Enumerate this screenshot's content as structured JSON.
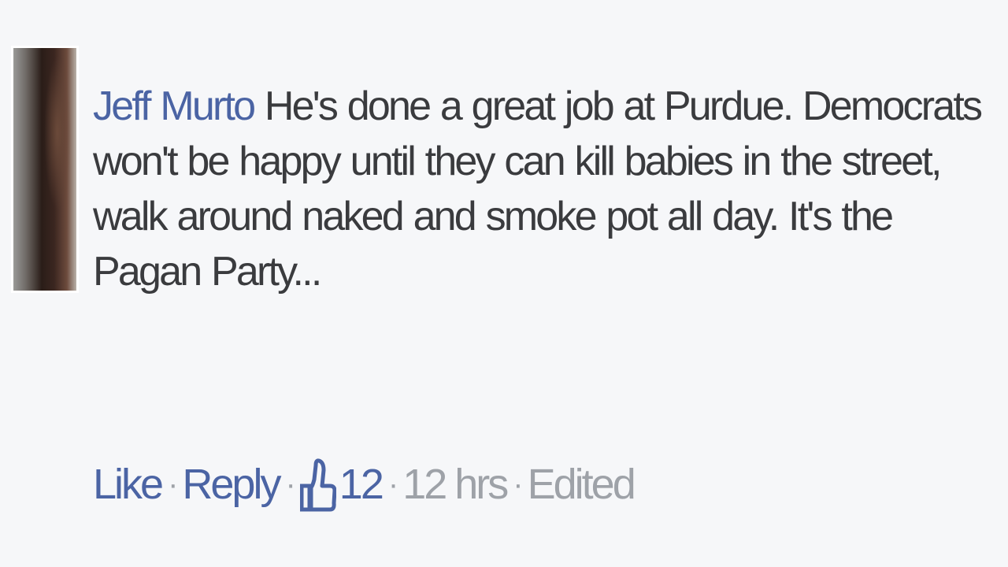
{
  "comment": {
    "author": "Jeff Murto",
    "text": "He's done a great job at Purdue. Democrats won't be happy until they can kill babies in the street, walk around naked and smoke pot all day. It's the Pagan Party...",
    "actions": {
      "like_label": "Like",
      "reply_label": "Reply",
      "like_count": "12",
      "time": "12 hrs",
      "edited_label": "Edited",
      "separator": "·"
    }
  },
  "icons": {
    "like_count_icon": "thumbs-up-icon"
  },
  "colors": {
    "background": "#f6f7f9",
    "link": "#4b64a4",
    "text": "#3a3b3e",
    "meta": "#9ea2a8"
  }
}
